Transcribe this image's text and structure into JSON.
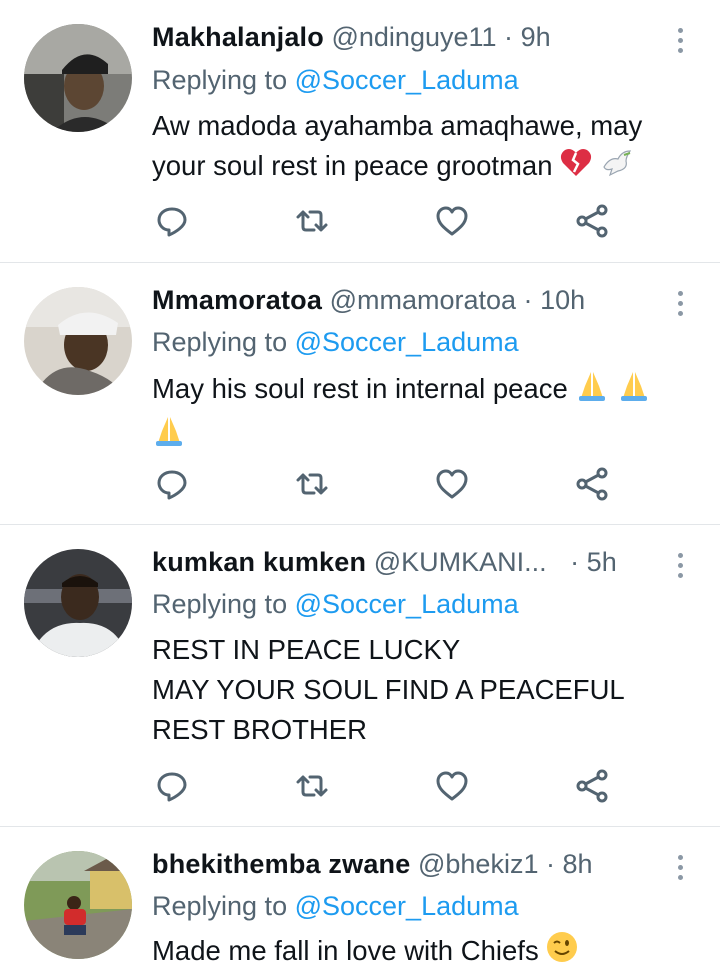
{
  "tweets": [
    {
      "name": "Makhalanjalo",
      "handle": "@ndinguye11",
      "dot": "·",
      "time": "9h",
      "replying_prefix": "Replying to",
      "replying_to": "@Soccer_Laduma",
      "text_lines": [
        "Aw madoda ayahamba amaqhawe, may",
        "your soul rest in peace grootman"
      ],
      "emojis": [
        "broken-heart-icon",
        "dove-icon"
      ]
    },
    {
      "name": "Mmamoratoa",
      "handle": "@mmamoratoa",
      "dot": "·",
      "time": "10h",
      "replying_prefix": "Replying to",
      "replying_to": "@Soccer_Laduma",
      "text_lines": [
        "May his soul rest in internal peace"
      ],
      "emojis": [
        "folded-hands-icon",
        "folded-hands-icon",
        "folded-hands-icon"
      ]
    },
    {
      "name": "kumkan kumken",
      "handle": "@KUMKANI...",
      "dot": "·",
      "time": "5h",
      "replying_prefix": "Replying to",
      "replying_to": "@Soccer_Laduma",
      "text_lines": [
        "REST IN PEACE LUCKY",
        "MAY YOUR SOUL FIND A PEACEFUL",
        "REST BROTHER"
      ],
      "emojis": []
    },
    {
      "name": "bhekithemba zwane",
      "handle": "@bhekiz1",
      "dot": "·",
      "time": "8h",
      "replying_prefix": "Replying to",
      "replying_to": "@Soccer_Laduma",
      "text_lines": [
        "Made me fall in love with Chiefs"
      ],
      "emojis": [
        "winking-face-icon"
      ]
    }
  ],
  "colors": {
    "accent": "#1d9bf0",
    "secondary_text": "#536471",
    "icon": "#536471",
    "divider": "#e3e6e9"
  },
  "action_icons": [
    "reply-icon",
    "retweet-icon",
    "like-icon",
    "share-icon"
  ]
}
